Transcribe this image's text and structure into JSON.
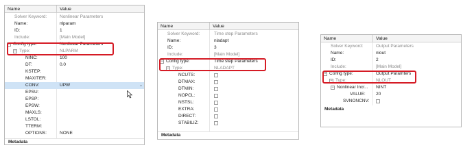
{
  "colors": {
    "highlight_border": "#d51b25",
    "selected_row": "#cfe3f6",
    "grid_line": "#cfcfcf"
  },
  "panels": [
    {
      "header": {
        "name": "Name",
        "value": "Value"
      },
      "rows": {
        "solver_keyword": {
          "name": "Solver Keyword:",
          "value": "Nonlinear Parameters"
        },
        "name": {
          "name": "Name:",
          "value": "nlparam"
        },
        "id": {
          "name": "ID:",
          "value": "1"
        },
        "include": {
          "name": "Include:",
          "value": "[Main Model]"
        },
        "config_type": {
          "name": "Config type:",
          "value": "Nonlinear Parameters"
        },
        "type": {
          "name": "Type:",
          "value": "NLPARM"
        },
        "params": [
          {
            "name": "NINC:",
            "value": "100"
          },
          {
            "name": "DT:",
            "value": "0.0"
          },
          {
            "name": "KSTEP:",
            "value": ""
          },
          {
            "name": "MAXITER:",
            "value": ""
          },
          {
            "name": "CONV:",
            "value": "UPW"
          },
          {
            "name": "EPSU:",
            "value": ""
          },
          {
            "name": "EPSP:",
            "value": ""
          },
          {
            "name": "EPSW:",
            "value": ""
          },
          {
            "name": "MAXLS:",
            "value": ""
          },
          {
            "name": "LSTOL:",
            "value": ""
          },
          {
            "name": "TTERM:",
            "value": ""
          },
          {
            "name": "OPTIONS:",
            "value": "NONE"
          }
        ]
      },
      "metadata": "Metadata"
    },
    {
      "header": {
        "name": "Name",
        "value": "Value"
      },
      "rows": {
        "solver_keyword": {
          "name": "Solver Keyword:",
          "value": "Time step Parameters"
        },
        "name": {
          "name": "Name:",
          "value": "nladapt"
        },
        "id": {
          "name": "ID:",
          "value": "3"
        },
        "include": {
          "name": "Include:",
          "value": "[Main Model]"
        },
        "config_type": {
          "name": "Config type:",
          "value": "Time step Parameters"
        },
        "type": {
          "name": "Type:",
          "value": "NLADAPT"
        },
        "params": [
          {
            "name": "NCUTS:"
          },
          {
            "name": "DTMAX:"
          },
          {
            "name": "DTMIN:"
          },
          {
            "name": "NOPCL:"
          },
          {
            "name": "NSTSL:"
          },
          {
            "name": "EXTRA:"
          },
          {
            "name": "DIRECT:"
          },
          {
            "name": "STABILIZ:"
          }
        ]
      },
      "metadata": "Metadata"
    },
    {
      "header": {
        "name": "Name",
        "value": "Value"
      },
      "rows": {
        "solver_keyword": {
          "name": "Solver Keyword:",
          "value": "Output Parameters"
        },
        "name": {
          "name": "Name:",
          "value": "nlout"
        },
        "id": {
          "name": "ID:",
          "value": "2"
        },
        "include": {
          "name": "Include:",
          "value": "[Main Model]"
        },
        "config_type": {
          "name": "Config type:",
          "value": "Output Paramters"
        },
        "type": {
          "name": "Type:",
          "value": "NLOUT"
        },
        "nonlinear_incr": {
          "name": "Nonlinear Incr...",
          "value": "NINT"
        },
        "value_row": {
          "name": "VALUE:",
          "value": "20"
        },
        "svnonconv": {
          "name": "SVNONCNV:"
        }
      },
      "metadata": "Metadata"
    }
  ]
}
